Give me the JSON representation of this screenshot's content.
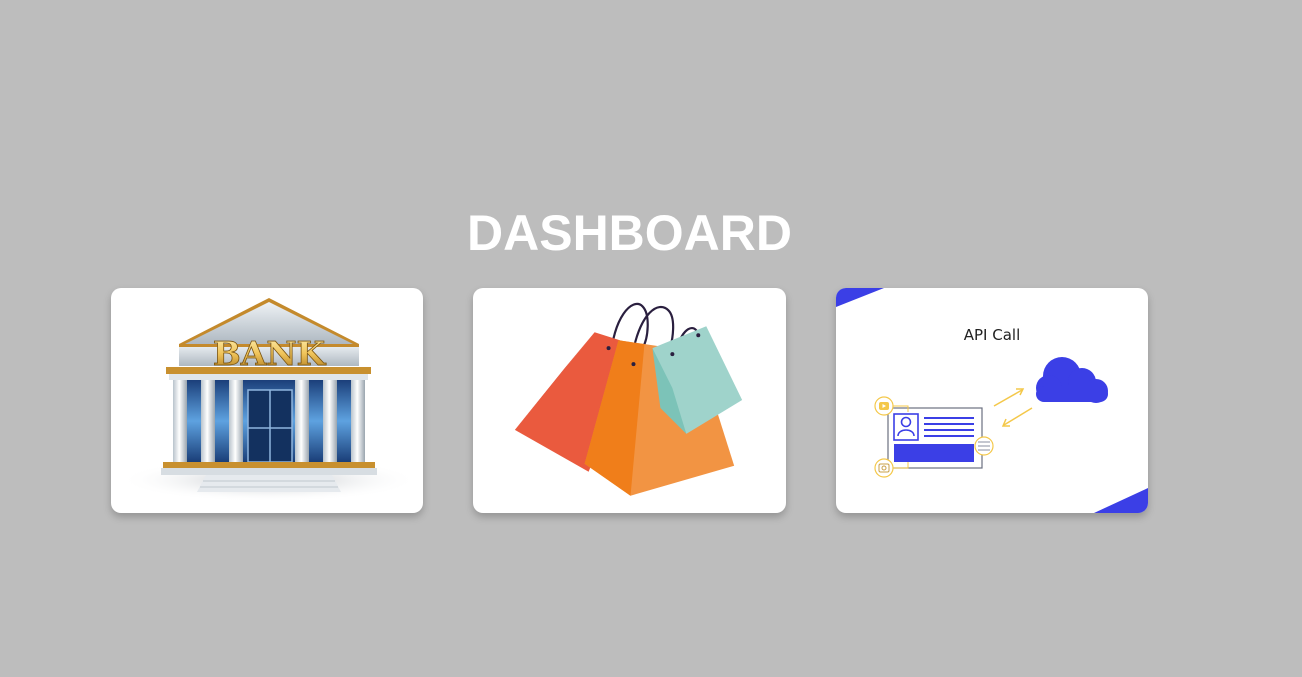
{
  "page": {
    "title": "DASHBOARD",
    "background_color": "#bdbdbd"
  },
  "cards": [
    {
      "name": "bank",
      "sign_text": "BANK",
      "icon": "bank-building-icon"
    },
    {
      "name": "shopping",
      "icon": "shopping-bags-icon"
    },
    {
      "name": "api-call",
      "caption": "API Call",
      "icon": "api-cloud-icon",
      "accent_color": "#3b3fe6"
    }
  ]
}
